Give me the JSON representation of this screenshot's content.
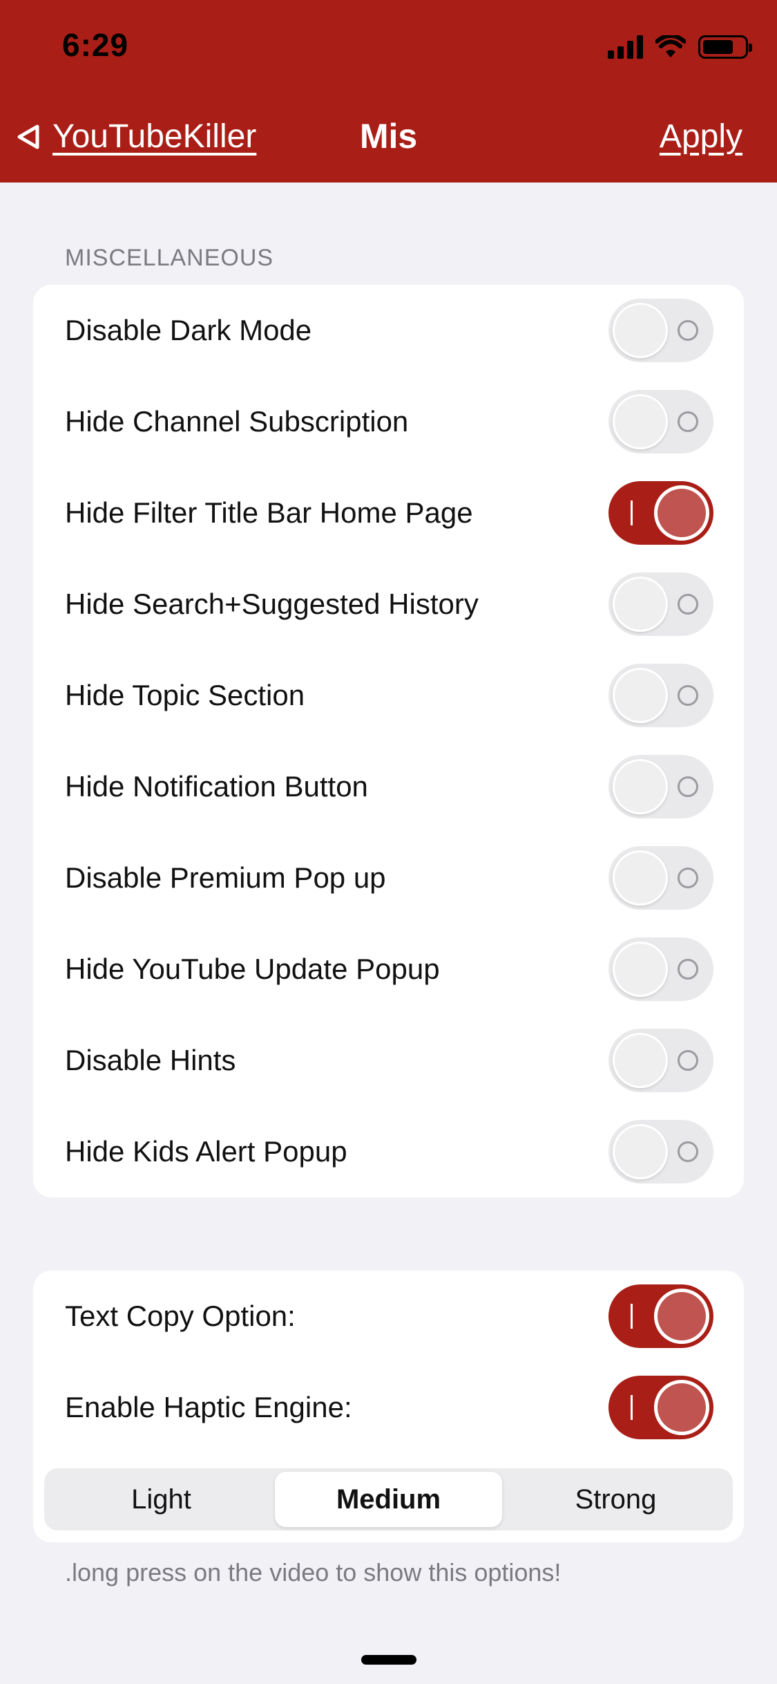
{
  "status_bar": {
    "time": "6:29"
  },
  "nav": {
    "back_label": "YouTubeKiller",
    "title": "Mis",
    "apply_label": "Apply"
  },
  "section": {
    "header": "MISCELLANEOUS",
    "items": [
      {
        "label": "Disable Dark Mode",
        "on": false
      },
      {
        "label": "Hide Channel Subscription",
        "on": false
      },
      {
        "label": "Hide Filter Title Bar Home Page",
        "on": true
      },
      {
        "label": "Hide Search+Suggested History",
        "on": false
      },
      {
        "label": "Hide Topic Section",
        "on": false
      },
      {
        "label": "Hide Notification Button",
        "on": false
      },
      {
        "label": "Disable Premium Pop up",
        "on": false
      },
      {
        "label": "Hide YouTube Update Popup",
        "on": false
      },
      {
        "label": "Disable Hints",
        "on": false
      },
      {
        "label": "Hide Kids Alert Popup",
        "on": false
      }
    ]
  },
  "options": {
    "text_copy_label": "Text Copy Option:",
    "text_copy_on": true,
    "haptic_label": "Enable Haptic Engine:",
    "haptic_on": true,
    "haptic_levels": [
      "Light",
      "Medium",
      "Strong"
    ],
    "haptic_selected": "Medium",
    "footer_note": ".long press on the video to show this options!"
  },
  "colors": {
    "accent": "#a91f17",
    "toggle_knob_on": "#c05450",
    "background": "#f1f1f6"
  },
  "icons": {
    "back": "chevron-left-icon",
    "signal": "cellular-signal-icon",
    "wifi": "wifi-icon",
    "battery": "battery-icon"
  }
}
